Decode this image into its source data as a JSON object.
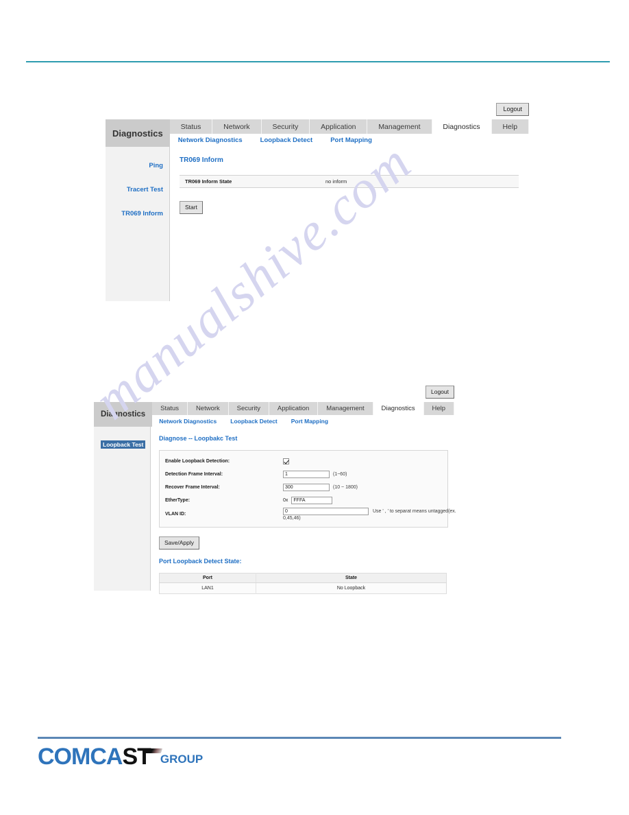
{
  "page": {
    "top_rule_color": "#2e9cb0",
    "bottom_rule_color": "#5b87b5",
    "watermark": "manualshive.com",
    "watermark_color": "#d5d5ef"
  },
  "logo": {
    "part_blue": "COMCA",
    "part_dark": "ST",
    "part_group": "GROUP",
    "blue": "#2f74bb",
    "dark": "#111111"
  },
  "shot_a": {
    "logout_label": "Logout",
    "brand": "Diagnostics",
    "tabs": [
      {
        "label": "Status",
        "active": false
      },
      {
        "label": "Network",
        "active": false
      },
      {
        "label": "Security",
        "active": false
      },
      {
        "label": "Application",
        "active": false
      },
      {
        "label": "Management",
        "active": false
      },
      {
        "label": "Diagnostics",
        "active": true
      },
      {
        "label": "Help",
        "active": false
      }
    ],
    "sublinks": [
      "Network Diagnostics",
      "Loopback Detect",
      "Port Mapping"
    ],
    "sidebar": [
      "Ping",
      "Tracert Test",
      "TR069 Inform"
    ],
    "title": "TR069 Inform",
    "state_row": {
      "key": "TR069 Inform State",
      "value": "no inform"
    },
    "start_label": "Start"
  },
  "shot_b": {
    "logout_label": "Logout",
    "brand": "Diagnostics",
    "tabs": [
      {
        "label": "Status",
        "active": false
      },
      {
        "label": "Network",
        "active": false
      },
      {
        "label": "Security",
        "active": false
      },
      {
        "label": "Application",
        "active": false
      },
      {
        "label": "Management",
        "active": false
      },
      {
        "label": "Diagnostics",
        "active": true
      },
      {
        "label": "Help",
        "active": false
      }
    ],
    "sublinks": [
      "Network Diagnostics",
      "Loopback Detect",
      "Port Mapping"
    ],
    "sidebar_selected": "Loopback Test",
    "selection_color": "#3a6ea5",
    "title": "Diagnose -- Loopbakc Test",
    "form": {
      "enable_label": "Enable Loopback Detection:",
      "enable_checked": true,
      "detection_label": "Detection Frame Interval:",
      "detection_value": "1",
      "detection_hint": "(1~60)",
      "recover_label": "Recover Frame Interval:",
      "recover_value": "300",
      "recover_hint": "(10 ~ 1800)",
      "ethertype_label": "EtherType:",
      "ethertype_prefix": "0x",
      "ethertype_value": "FFFA",
      "vlan_label": "VLAN ID:",
      "vlan_value": "0",
      "vlan_hint_1": "Use ' , ' to separat means untagged(ex.",
      "vlan_hint_2": "0,45,46)"
    },
    "save_label": "Save/Apply",
    "table_title": "Port Loopback Detect State:",
    "table": {
      "headers": [
        "Port",
        "State"
      ],
      "rows": [
        [
          "LAN1",
          "No Loopback"
        ]
      ]
    }
  }
}
